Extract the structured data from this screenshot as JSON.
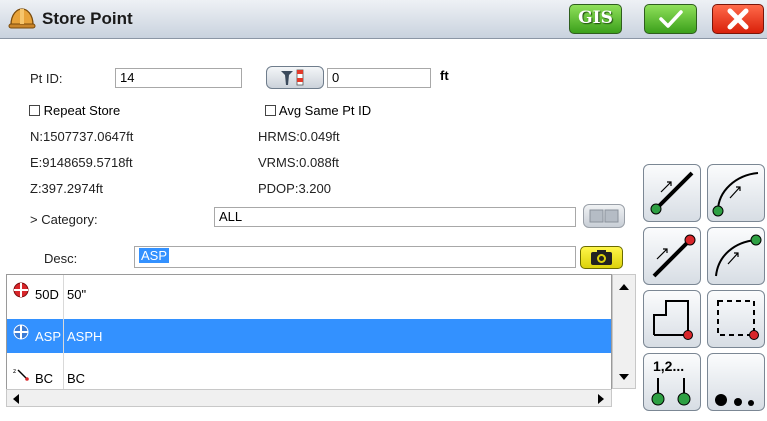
{
  "window": {
    "title": "Store Point"
  },
  "toolbar": {
    "gis_label": "GIS"
  },
  "form": {
    "pt_id_label": "Pt ID:",
    "pt_id_value": "14",
    "rod_height_value": "0",
    "rod_height_unit": "ft",
    "repeat_store_label": "Repeat Store",
    "avg_same_label": "Avg Same Pt ID",
    "northing": "N:1507737.0647ft",
    "easting": "E:9148659.5718ft",
    "elevation": "Z:397.2974ft",
    "hrms": "HRMS:0.049ft",
    "vrms": "VRMS:0.088ft",
    "pdop": "PDOP:3.200",
    "category_label": "> Category:",
    "category_value": "ALL",
    "desc_label": "Desc:",
    "desc_value": "ASP"
  },
  "code_list": [
    {
      "code": "50D",
      "description": "50\"",
      "icon": "red-target-icon",
      "selected": false
    },
    {
      "code": "ASP",
      "description": "ASPH",
      "icon": "blue-target-icon",
      "selected": true
    },
    {
      "code": "BC",
      "description": "BC",
      "icon": "line-point-icon",
      "selected": false
    }
  ],
  "tools": {
    "numbering_label": "1,2..."
  },
  "colors": {
    "selection": "#3391ff",
    "accent_green": "#3ba01b",
    "cancel_red": "#d9200a"
  }
}
